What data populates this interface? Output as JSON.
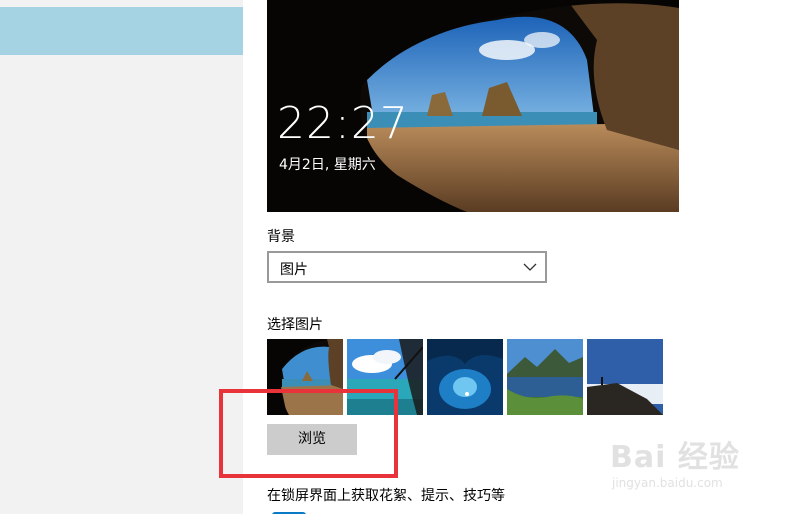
{
  "preview": {
    "time": "22:27",
    "date": "4月2日, 星期六"
  },
  "background_section": {
    "label": "背景",
    "selected_value": "图片"
  },
  "choose_picture": {
    "label": "选择图片",
    "thumbnails": [
      "cave-beach",
      "boat-sea",
      "ice-cave",
      "mountain-lake",
      "cliff-clouds"
    ]
  },
  "browse_button": {
    "label": "浏览"
  },
  "fun_facts": {
    "label": "在锁屏界面上获取花絮、提示、技巧等"
  },
  "watermark": {
    "brand": "Bai 经验",
    "url": "jingyan.baidu.com"
  },
  "colors": {
    "nav_selected": "#a6d3e4",
    "annotation_red": "#e8333a",
    "button_gray": "#cccccc"
  }
}
